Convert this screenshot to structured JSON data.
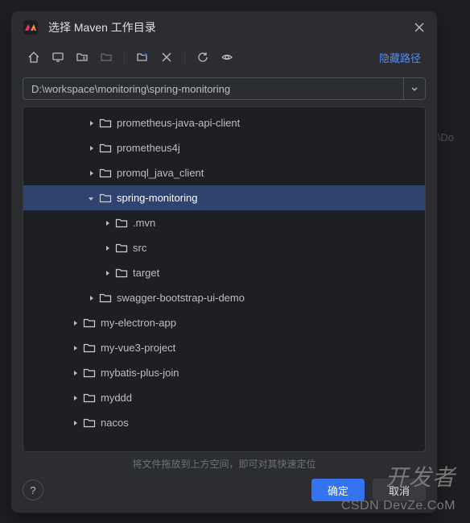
{
  "dialog": {
    "title": "选择 Maven 工作目录",
    "hide_path": "隐藏路径",
    "path": "D:\\workspace\\monitoring\\spring-monitoring",
    "hint": "将文件拖放到上方空间，即可对其快速定位",
    "ok": "确定",
    "cancel": "取消"
  },
  "tree": [
    {
      "label": "prometheus-java-api-client",
      "depth": 3,
      "expanded": false,
      "selected": false
    },
    {
      "label": "prometheus4j",
      "depth": 3,
      "expanded": false,
      "selected": false
    },
    {
      "label": "promql_java_client",
      "depth": 3,
      "expanded": false,
      "selected": false
    },
    {
      "label": "spring-monitoring",
      "depth": 3,
      "expanded": true,
      "selected": true
    },
    {
      "label": ".mvn",
      "depth": 4,
      "expanded": false,
      "selected": false
    },
    {
      "label": "src",
      "depth": 4,
      "expanded": false,
      "selected": false
    },
    {
      "label": "target",
      "depth": 4,
      "expanded": false,
      "selected": false
    },
    {
      "label": "swagger-bootstrap-ui-demo",
      "depth": 3,
      "expanded": false,
      "selected": false
    },
    {
      "label": "my-electron-app",
      "depth": 2,
      "expanded": false,
      "selected": false
    },
    {
      "label": "my-vue3-project",
      "depth": 2,
      "expanded": false,
      "selected": false
    },
    {
      "label": "mybatis-plus-join",
      "depth": 2,
      "expanded": false,
      "selected": false
    },
    {
      "label": "myddd",
      "depth": 2,
      "expanded": false,
      "selected": false
    },
    {
      "label": "nacos",
      "depth": 2,
      "expanded": false,
      "selected": false
    }
  ],
  "bg": {
    "path_fragment": "ring\\Do"
  },
  "watermark": {
    "line1": "开发者",
    "line2": "CSDN DevZe.CoM"
  }
}
